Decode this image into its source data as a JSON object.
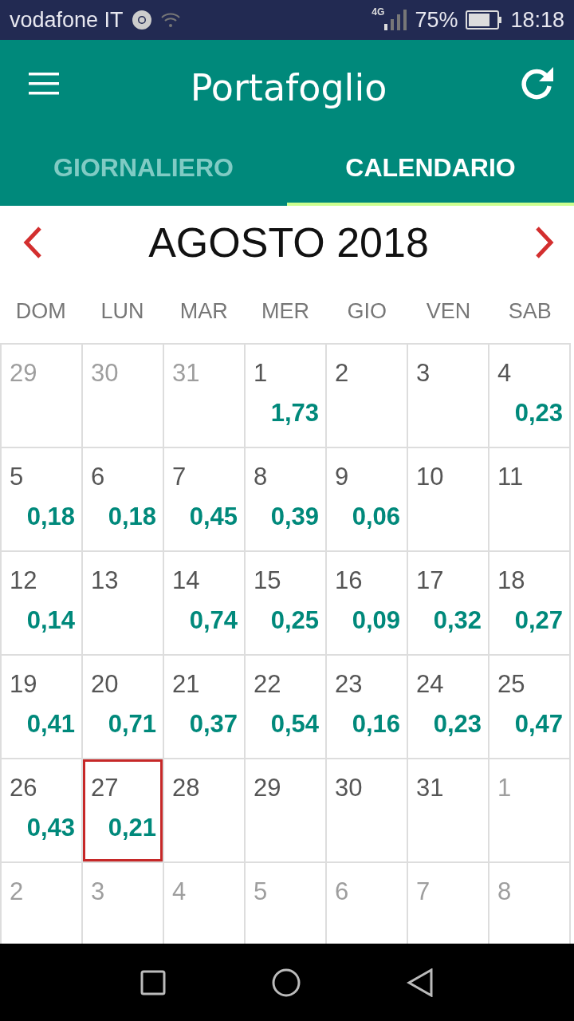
{
  "status_bar": {
    "carrier": "vodafone IT",
    "network": "4G",
    "battery": "75%",
    "time": "18:18"
  },
  "app_bar": {
    "title": "Portafoglio"
  },
  "tabs": [
    {
      "label": "GIORNALIERO",
      "selected": false
    },
    {
      "label": "CALENDARIO",
      "selected": true
    }
  ],
  "month": {
    "title": "AGOSTO 2018"
  },
  "weekdays": [
    "DOM",
    "LUN",
    "MAR",
    "MER",
    "GIO",
    "VEN",
    "SAB"
  ],
  "weeks": [
    [
      {
        "day": "29",
        "outside": true,
        "selected": false
      },
      {
        "day": "30",
        "outside": true,
        "selected": false
      },
      {
        "day": "31",
        "outside": true,
        "selected": false
      },
      {
        "day": "1",
        "value": "1,73",
        "outside": false,
        "selected": false
      },
      {
        "day": "2",
        "outside": false,
        "selected": false
      },
      {
        "day": "3",
        "outside": false,
        "selected": false
      },
      {
        "day": "4",
        "value": "0,23",
        "outside": false,
        "selected": false
      }
    ],
    [
      {
        "day": "5",
        "value": "0,18",
        "outside": false,
        "selected": false
      },
      {
        "day": "6",
        "value": "0,18",
        "outside": false,
        "selected": false
      },
      {
        "day": "7",
        "value": "0,45",
        "outside": false,
        "selected": false
      },
      {
        "day": "8",
        "value": "0,39",
        "outside": false,
        "selected": false
      },
      {
        "day": "9",
        "value": "0,06",
        "outside": false,
        "selected": false
      },
      {
        "day": "10",
        "outside": false,
        "selected": false
      },
      {
        "day": "11",
        "outside": false,
        "selected": false
      }
    ],
    [
      {
        "day": "12",
        "value": "0,14",
        "outside": false,
        "selected": false
      },
      {
        "day": "13",
        "outside": false,
        "selected": false
      },
      {
        "day": "14",
        "value": "0,74",
        "outside": false,
        "selected": false
      },
      {
        "day": "15",
        "value": "0,25",
        "outside": false,
        "selected": false
      },
      {
        "day": "16",
        "value": "0,09",
        "outside": false,
        "selected": false
      },
      {
        "day": "17",
        "value": "0,32",
        "outside": false,
        "selected": false
      },
      {
        "day": "18",
        "value": "0,27",
        "outside": false,
        "selected": false
      }
    ],
    [
      {
        "day": "19",
        "value": "0,41",
        "outside": false,
        "selected": false
      },
      {
        "day": "20",
        "value": "0,71",
        "outside": false,
        "selected": false
      },
      {
        "day": "21",
        "value": "0,37",
        "outside": false,
        "selected": false
      },
      {
        "day": "22",
        "value": "0,54",
        "outside": false,
        "selected": false
      },
      {
        "day": "23",
        "value": "0,16",
        "outside": false,
        "selected": false
      },
      {
        "day": "24",
        "value": "0,23",
        "outside": false,
        "selected": false
      },
      {
        "day": "25",
        "value": "0,47",
        "outside": false,
        "selected": false
      }
    ],
    [
      {
        "day": "26",
        "value": "0,43",
        "outside": false,
        "selected": false
      },
      {
        "day": "27",
        "value": "0,21",
        "outside": false,
        "selected": true
      },
      {
        "day": "28",
        "outside": false,
        "selected": false
      },
      {
        "day": "29",
        "outside": false,
        "selected": false
      },
      {
        "day": "30",
        "outside": false,
        "selected": false
      },
      {
        "day": "31",
        "outside": false,
        "selected": false
      },
      {
        "day": "1",
        "outside": true,
        "selected": false
      }
    ],
    [
      {
        "day": "2",
        "outside": true,
        "selected": false
      },
      {
        "day": "3",
        "outside": true,
        "selected": false
      },
      {
        "day": "4",
        "outside": true,
        "selected": false
      },
      {
        "day": "5",
        "outside": true,
        "selected": false
      },
      {
        "day": "6",
        "outside": true,
        "selected": false
      },
      {
        "day": "7",
        "outside": true,
        "selected": false
      },
      {
        "day": "8",
        "outside": true,
        "selected": false
      }
    ]
  ]
}
